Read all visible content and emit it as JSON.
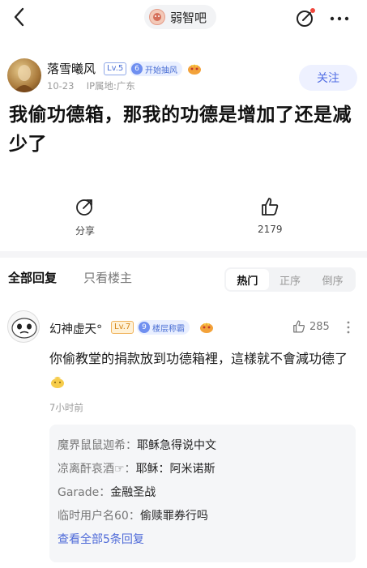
{
  "header": {
    "forum_name": "弱智吧"
  },
  "post": {
    "author": "落雪曦风",
    "author_level": "Lv.5",
    "author_title_num": "6",
    "author_title": "开始抽风",
    "date": "10-23",
    "location": "IP属地:广东",
    "follow_label": "关注",
    "title": "我偷功德箱，那我的功德是增加了还是减少了",
    "share_label": "分享",
    "like_count": "2179"
  },
  "replies": {
    "tab_all": "全部回复",
    "tab_op": "只看楼主",
    "sort_options": [
      "热门",
      "正序",
      "倒序"
    ],
    "active_sort": "热门"
  },
  "comment": {
    "author": "幻神虚天°",
    "level": "Lv.7",
    "title_num": "9",
    "title": "楼层称霸",
    "like_count": "285",
    "text": "你偷教堂的捐款放到功德箱裡，這樣就不會減功德了",
    "time": "7小时前",
    "sub_replies": [
      {
        "name": "魔界鼠鼠迦希：",
        "content": "耶稣急得说中文"
      },
      {
        "name": "凉离酐哀酒☞：",
        "content": "耶稣：阿米诺斯"
      },
      {
        "name": "Garade：",
        "content": "金融圣战"
      },
      {
        "name": "临时用户名60：",
        "content": "偷赎罪券行吗"
      }
    ],
    "view_all": "查看全部5条回复"
  },
  "colors": {
    "accent": "#5470e4",
    "badge_bg": "#e9efff",
    "level_orange": "#d4861a"
  }
}
